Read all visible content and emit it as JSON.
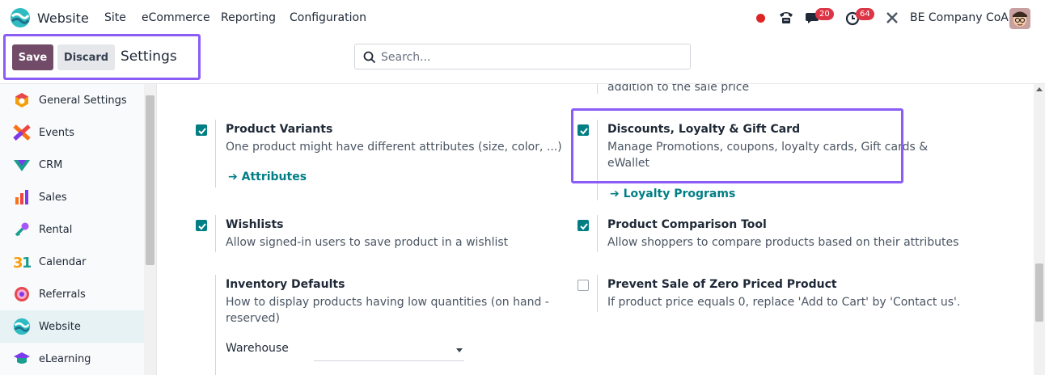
{
  "navbar": {
    "app_name": "Website",
    "menu": [
      "Site",
      "eCommerce",
      "Reporting",
      "Configuration"
    ],
    "messages_count": "20",
    "activities_count": "64",
    "company": "BE Company CoA"
  },
  "control_panel": {
    "save_label": "Save",
    "discard_label": "Discard",
    "title": "Settings",
    "search_placeholder": "Search..."
  },
  "sidebar": {
    "items": [
      {
        "label": "General Settings",
        "icon": "general-settings-icon"
      },
      {
        "label": "Events",
        "icon": "events-icon"
      },
      {
        "label": "CRM",
        "icon": "crm-icon"
      },
      {
        "label": "Sales",
        "icon": "sales-icon"
      },
      {
        "label": "Rental",
        "icon": "rental-icon"
      },
      {
        "label": "Calendar",
        "icon": "calendar-icon"
      },
      {
        "label": "Referrals",
        "icon": "referrals-icon"
      },
      {
        "label": "Website",
        "icon": "website-icon",
        "active": true
      },
      {
        "label": "eLearning",
        "icon": "elearning-icon"
      }
    ]
  },
  "settings": {
    "top_partial_text": "addition to the sale price",
    "product_variants": {
      "checked": true,
      "title": "Product Variants",
      "desc": "One product might have different attributes (size, color, ...)",
      "link": "Attributes"
    },
    "discounts": {
      "checked": true,
      "title": "Discounts, Loyalty & Gift Card",
      "desc_line1": "Manage Promotions, coupons, loyalty cards, Gift cards &",
      "desc_line2": "eWallet",
      "link": "Loyalty Programs"
    },
    "wishlists": {
      "checked": true,
      "title": "Wishlists",
      "desc": "Allow signed-in users to save product in a wishlist"
    },
    "comparison": {
      "checked": true,
      "title": "Product Comparison Tool",
      "desc": "Allow shoppers to compare products based on their attributes"
    },
    "inventory": {
      "title": "Inventory Defaults",
      "desc_line1": "How to display products having low quantities (on hand -",
      "desc_line2": "reserved)",
      "warehouse_label": "Warehouse",
      "warehouse_value": ""
    },
    "zero_price": {
      "checked": false,
      "title": "Prevent Sale of Zero Priced Product",
      "desc": "If product price equals 0, replace 'Add to Cart' by 'Contact us'."
    }
  },
  "colors": {
    "brand": "#714b67",
    "accent": "#017e84",
    "highlight": "#8b5cf6",
    "badge": "#dc3545"
  }
}
